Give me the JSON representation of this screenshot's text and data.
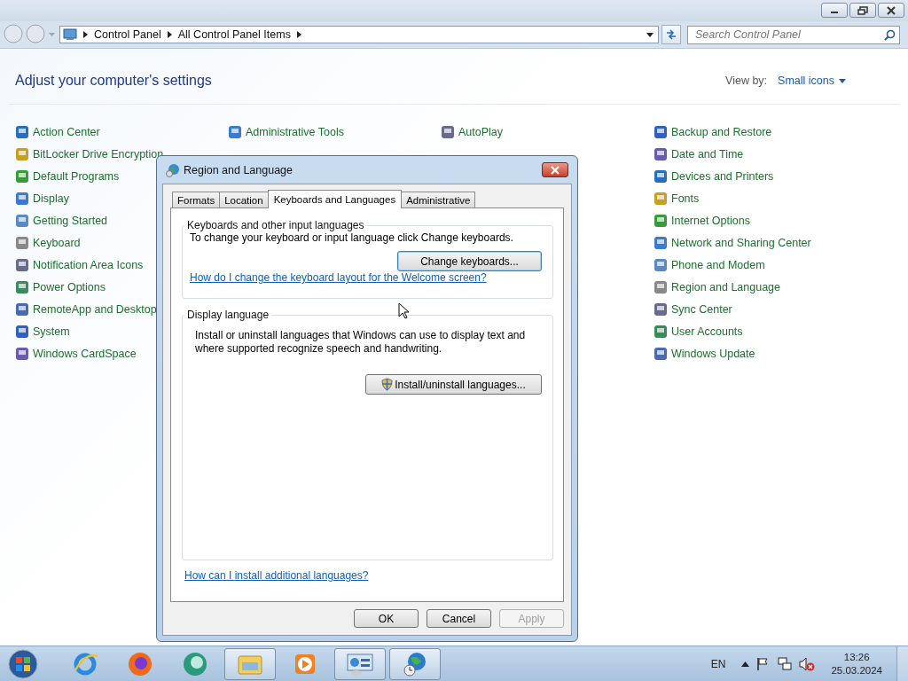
{
  "address_bar": {
    "breadcrumbs": [
      "Control Panel",
      "All Control Panel Items"
    ]
  },
  "search": {
    "placeholder": "Search Control Panel"
  },
  "heading": "Adjust your computer's settings",
  "view_by": {
    "label": "View by:",
    "value": "Small icons"
  },
  "columns": [
    [
      "Action Center",
      "BitLocker Drive Encryption",
      "Default Programs",
      "Display",
      "Getting Started",
      "Keyboard",
      "Notification Area Icons",
      "Power Options",
      "RemoteApp and Desktop",
      "System",
      "Windows CardSpace"
    ],
    [
      "Administrative Tools"
    ],
    [
      "AutoPlay"
    ],
    [
      "Backup and Restore",
      "Date and Time",
      "Devices and Printers",
      "Fonts",
      "Internet Options",
      "Network and Sharing Center",
      "Phone and Modem",
      "Region and Language",
      "Sync Center",
      "User Accounts",
      "Windows Update"
    ]
  ],
  "dialog": {
    "title": "Region and Language",
    "tabs": [
      {
        "label": "Formats",
        "selected": false
      },
      {
        "label": "Location",
        "selected": false
      },
      {
        "label": "Keyboards and Languages",
        "selected": true
      },
      {
        "label": "Administrative",
        "selected": false
      }
    ],
    "keyboards_group": {
      "legend": "Keyboards and other input languages",
      "text": "To change your keyboard or input language click Change keyboards.",
      "button": "Change keyboards...",
      "link": "How do I change the keyboard layout for the Welcome screen?"
    },
    "display_group": {
      "legend": "Display language",
      "text": "Install or uninstall languages that Windows can use to display text and where supported recognize speech and handwriting.",
      "button": "Install/uninstall languages..."
    },
    "help_link": "How can I install additional languages?",
    "buttons": [
      {
        "label": "OK",
        "disabled": false
      },
      {
        "label": "Cancel",
        "disabled": false
      },
      {
        "label": "Apply",
        "disabled": true
      }
    ]
  },
  "taskbar": {
    "apps": [
      {
        "kind": "ie",
        "running": false
      },
      {
        "kind": "firefox",
        "running": false
      },
      {
        "kind": "orb",
        "running": false
      },
      {
        "kind": "explorer",
        "running": true
      },
      {
        "kind": "media",
        "running": false
      },
      {
        "kind": "controlpanel",
        "running": true
      },
      {
        "kind": "region",
        "running": true
      }
    ],
    "language": "EN",
    "time": "13:26",
    "date": "25.03.2024"
  }
}
